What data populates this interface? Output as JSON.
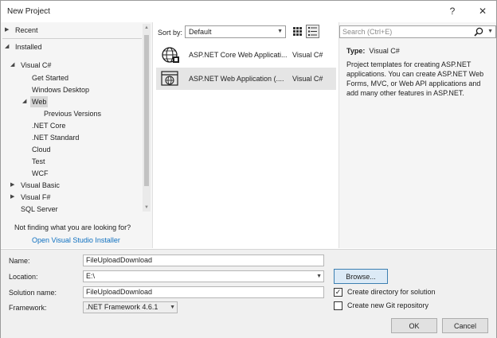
{
  "window": {
    "title": "New Project",
    "help_label": "?",
    "close_label": "✕"
  },
  "tree": {
    "recent": "Recent",
    "installed": "Installed",
    "visual_csharp": "Visual C#",
    "get_started": "Get Started",
    "windows_desktop": "Windows Desktop",
    "web": "Web",
    "previous_versions": "Previous Versions",
    "net_core": ".NET Core",
    "net_standard": ".NET Standard",
    "cloud": "Cloud",
    "test": "Test",
    "wcf": "WCF",
    "visual_basic": "Visual Basic",
    "visual_fsharp": "Visual F#",
    "sql_server": "SQL Server",
    "not_finding": "Not finding what you are looking for?",
    "installer_link": "Open Visual Studio Installer"
  },
  "templates": {
    "sort_label": "Sort by:",
    "sort_value": "Default",
    "items": [
      {
        "name": "ASP.NET Core Web Applicati...",
        "lang": "Visual C#"
      },
      {
        "name": "ASP.NET Web Application (....",
        "lang": "Visual C#"
      }
    ]
  },
  "details": {
    "search_placeholder": "Search (Ctrl+E)",
    "type_label": "Type:",
    "type_value": "Visual C#",
    "description": "Project templates for creating ASP.NET applications. You can create ASP.NET Web Forms, MVC, or Web API applications and add many other features in ASP.NET."
  },
  "form": {
    "name_label": "Name:",
    "name_value": "FileUploadDownload",
    "location_label": "Location:",
    "location_value": "E:\\",
    "solution_label": "Solution name:",
    "solution_value": "FileUploadDownload",
    "framework_label": "Framework:",
    "framework_value": ".NET Framework 4.6.1",
    "browse_label": "Browse...",
    "create_dir_label": "Create directory for solution",
    "create_dir_checked": true,
    "create_git_label": "Create new Git repository",
    "create_git_checked": false,
    "ok_label": "OK",
    "cancel_label": "Cancel"
  },
  "colors": {
    "link": "#0e70c0",
    "selection": "#d6d6d6",
    "panel": "#f5f5f5",
    "focus_border": "#3c7fb1"
  }
}
